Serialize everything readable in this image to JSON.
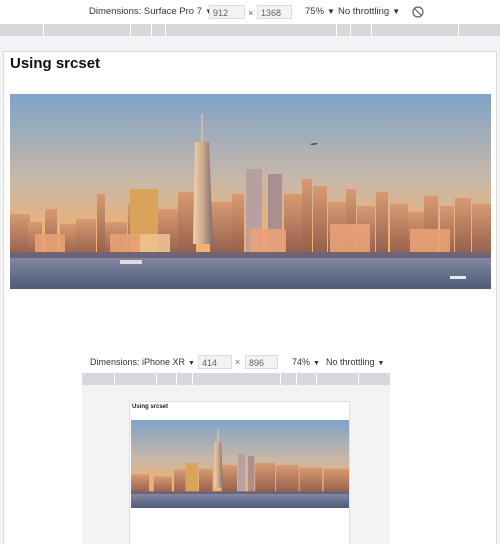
{
  "toolbar": {
    "dimensions_label": "Dimensions: Surface Pro 7",
    "width": "912",
    "times": "×",
    "height": "1368",
    "zoom": "75%",
    "throttling": "No throttling",
    "rotate_icon": "rotate-icon"
  },
  "page": {
    "title": "Using srcset",
    "hero_image": "city-skyline-photo"
  },
  "nested": {
    "dimensions_label": "Dimensions: iPhone XR",
    "width": "414",
    "times": "×",
    "height": "896",
    "zoom": "74%",
    "throttling": "No throttling",
    "title": "Using srcset",
    "hero_image": "city-skyline-photo"
  },
  "colors": {
    "sky_top": "#7fa3c8",
    "sky_horizon": "#f2b06a",
    "water": "#5d6a86",
    "toolbar_input_bg": "#f1f3f4"
  }
}
